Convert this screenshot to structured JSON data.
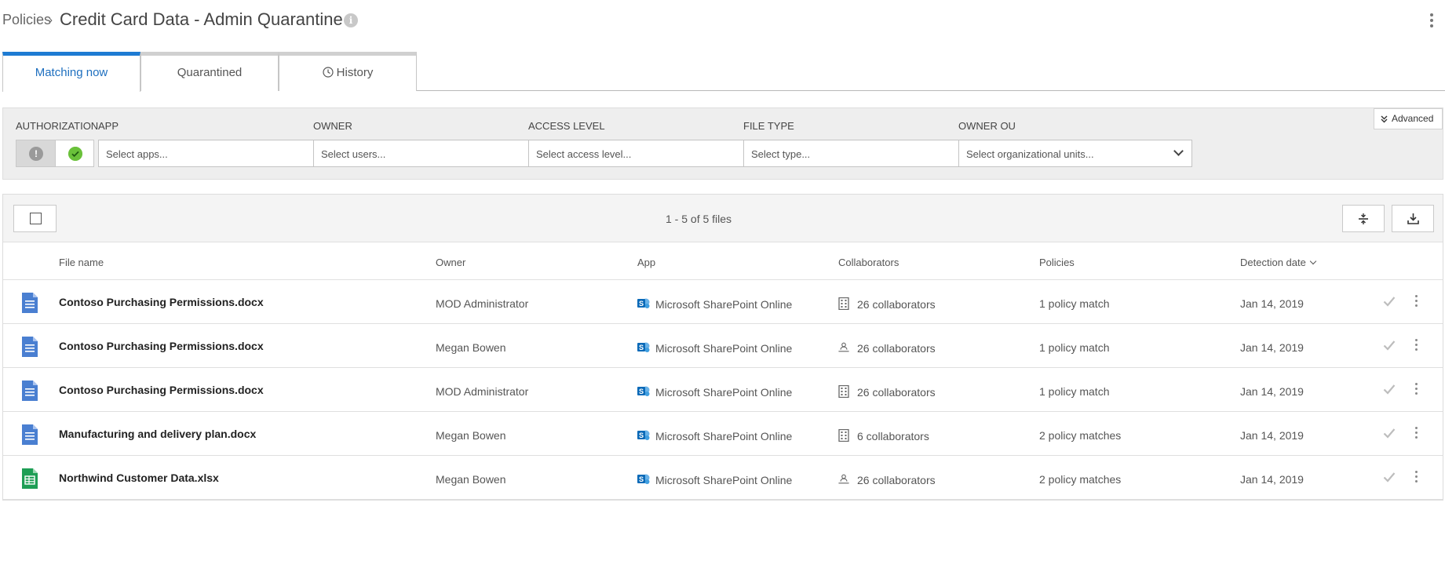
{
  "header": {
    "breadcrumb": "Policies",
    "separator": "›",
    "title": "Credit Card Data - Admin Quarantine",
    "info_icon": "i"
  },
  "tabs": [
    {
      "label": "Matching now",
      "active": true
    },
    {
      "label": "Quarantined",
      "active": false
    },
    {
      "label": "History",
      "active": false,
      "icon": "clock-icon"
    }
  ],
  "filters": {
    "authorization": {
      "label": "AUTHORIZATION",
      "warn_symbol": "!"
    },
    "app": {
      "label": "APP",
      "placeholder": "Select apps..."
    },
    "owner": {
      "label": "OWNER",
      "placeholder": "Select users..."
    },
    "access_level": {
      "label": "ACCESS LEVEL",
      "placeholder": "Select access level..."
    },
    "file_type": {
      "label": "FILE TYPE",
      "placeholder": "Select type..."
    },
    "owner_ou": {
      "label": "OWNER OU",
      "placeholder": "Select organizational units..."
    },
    "advanced": "Advanced"
  },
  "toolbar": {
    "count": "1 - 5 of 5 files"
  },
  "columns": {
    "file_name": "File name",
    "owner": "Owner",
    "app": "App",
    "collaborators": "Collaborators",
    "policies": "Policies",
    "detection_date": "Detection date"
  },
  "rows": [
    {
      "file": "Contoso Purchasing Permissions.docx",
      "type": "docx",
      "owner": "MOD Administrator",
      "app": "Microsoft SharePoint Online",
      "collab_icon": "building-icon",
      "collaborators": "26 collaborators",
      "policies": "1 policy match",
      "date": "Jan 14, 2019"
    },
    {
      "file": "Contoso Purchasing Permissions.docx",
      "type": "docx",
      "owner": "Megan Bowen",
      "app": "Microsoft SharePoint Online",
      "collab_icon": "external-users-icon",
      "collaborators": "26 collaborators",
      "policies": "1 policy match",
      "date": "Jan 14, 2019"
    },
    {
      "file": "Contoso Purchasing Permissions.docx",
      "type": "docx",
      "owner": "MOD Administrator",
      "app": "Microsoft SharePoint Online",
      "collab_icon": "building-icon",
      "collaborators": "26 collaborators",
      "policies": "1 policy match",
      "date": "Jan 14, 2019"
    },
    {
      "file": "Manufacturing and delivery plan.docx",
      "type": "docx",
      "owner": "Megan Bowen",
      "app": "Microsoft SharePoint Online",
      "collab_icon": "building-icon",
      "collaborators": "6 collaborators",
      "policies": "2 policy matches",
      "date": "Jan 14, 2019"
    },
    {
      "file": "Northwind Customer Data.xlsx",
      "type": "xlsx",
      "owner": "Megan Bowen",
      "app": "Microsoft SharePoint Online",
      "collab_icon": "external-users-icon",
      "collaborators": "26 collaborators",
      "policies": "2 policy matches",
      "date": "Jan 14, 2019"
    }
  ],
  "colors": {
    "accent": "#1e7bd3",
    "ok_green": "#6ac13a",
    "docx_blue": "#4a7fd1",
    "xlsx_green": "#1e9e55"
  }
}
